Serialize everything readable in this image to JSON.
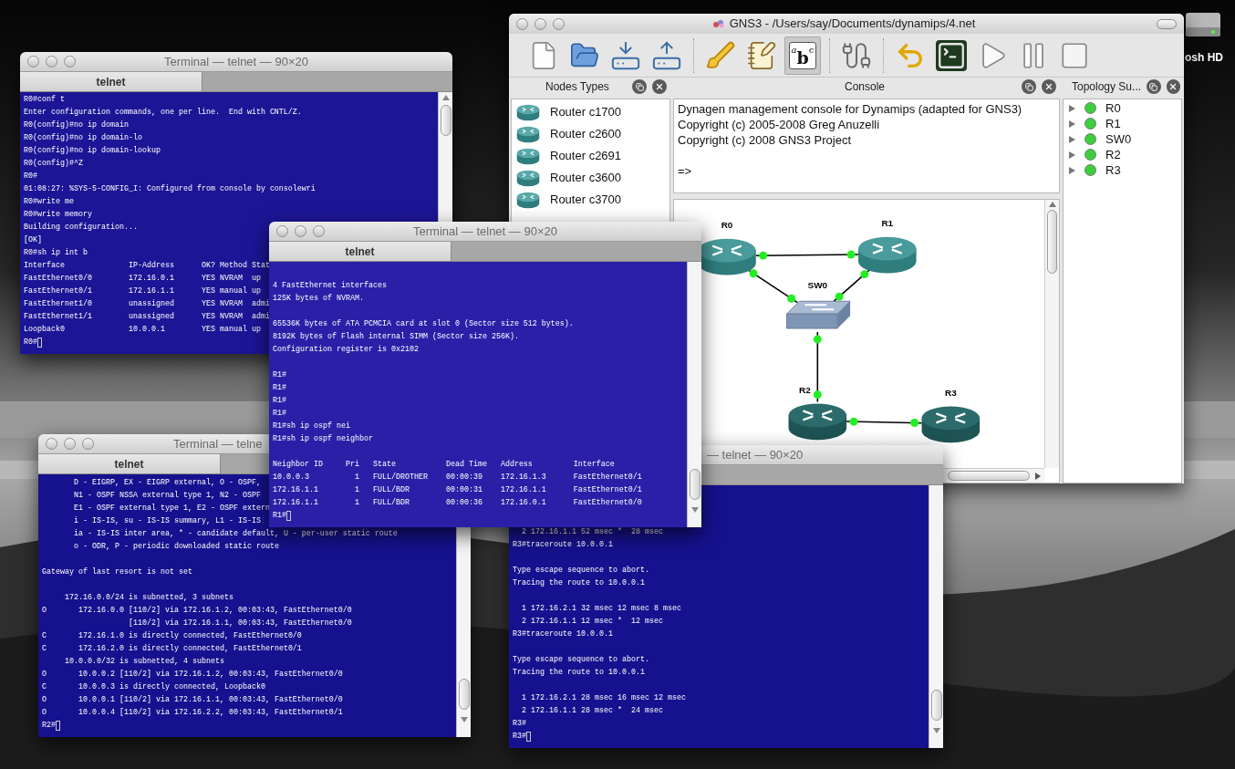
{
  "desktop": {
    "drive_label": "osh HD"
  },
  "terminals": [
    {
      "title": "Terminal — telnet — 90×20",
      "tab": "telnet",
      "cursor": true,
      "blocks": [
        [
          "R0#conf t",
          "Enter configuration commands, one per line.  End with CNTL/Z.",
          "R0(config)#no ip domain",
          "R0(config)#no ip domain-lo",
          "R0(config)#no ip domain-lookup",
          "R0(config)#^Z",
          "R0#",
          "01:08:27: %SYS-5-CONFIG_I: Configured from console by consolewri",
          "R0#write me",
          "R0#write memory",
          "Building configuration...",
          "[OK]",
          "R0#sh ip int b",
          "Interface              IP-Address      OK? Method Stat",
          "FastEthernet0/0        172.16.0.1      YES NVRAM  up",
          "FastEthernet0/1        172.16.1.1      YES manual up",
          "FastEthernet1/0        unassigned      YES NVRAM  admi",
          "FastEthernet1/1        unassigned      YES NVRAM  admi",
          "Loopback0              10.0.0.1        YES manual up",
          "R0#"
        ]
      ]
    },
    {
      "title": "Terminal — telnet — 90×20",
      "tab": "telnet",
      "cursor": true,
      "blocks": [
        [
          "4 FastEthernet interfaces",
          "125K bytes of NVRAM."
        ],
        [
          "65536K bytes of ATA PCMCIA card at slot 0 (Sector size 512 bytes).",
          "8192K bytes of Flash internal SIMM (Sector size 256K).",
          "Configuration register is 0x2102"
        ],
        [
          "R1#",
          "R1#",
          "R1#",
          "R1#",
          "R1#sh ip ospf nei",
          "R1#sh ip ospf neighbor"
        ],
        [
          "Neighbor ID     Pri   State           Dead Time   Address         Interface",
          "10.0.0.3          1   FULL/DROTHER    00:00:39    172.16.1.3      FastEthernet0/1",
          "172.16.1.1        1   FULL/BDR        00:00:31    172.16.1.1      FastEthernet0/1",
          "172.16.1.1        1   FULL/BDR        00:00:36    172.16.0.1      FastEthernet0/0",
          "R1#"
        ]
      ]
    },
    {
      "title": "Terminal — telne",
      "tab": "telnet",
      "cursor": true,
      "blocks": [
        [
          "       D - EIGRP, EX - EIGRP external, O - OSPF,",
          "       N1 - OSPF NSSA external type 1, N2 - OSPF",
          "       E1 - OSPF external type 1, E2 - OSPF extern",
          "       i - IS-IS, su - IS-IS summary, L1 - IS-IS",
          "       ia - IS-IS inter area, * - candidate default, U - per-user static route",
          "       o - ODR, P - periodic downloaded static route"
        ],
        [
          "Gateway of last resort is not set"
        ],
        [
          "     172.16.0.0/24 is subnetted, 3 subnets",
          "O       172.16.0.0 [110/2] via 172.16.1.2, 00:03:43, FastEthernet0/0",
          "                   [110/2] via 172.16.1.1, 00:03:43, FastEthernet0/0",
          "C       172.16.1.0 is directly connected, FastEthernet0/0",
          "C       172.16.2.0 is directly connected, FastEthernet0/1",
          "     10.0.0.0/32 is subnetted, 4 subnets",
          "O       10.0.0.2 [110/2] via 172.16.1.2, 00:03:43, FastEthernet0/0",
          "C       10.0.0.3 is directly connected, Loopback0",
          "O       10.0.0.1 [110/2] via 172.16.1.1, 00:03:43, FastEthernet0/0",
          "O       10.0.0.4 [110/2] via 172.16.2.2, 00:03:43, FastEthernet0/1",
          "R2#"
        ]
      ]
    },
    {
      "title": "— telnet — 90×20",
      "cursor": true,
      "blocks": [
        [
          "  2 172.16.1.1 52 msec *  28 msec",
          "R3#traceroute 10.0.0.1"
        ],
        [
          "Type escape sequence to abort.",
          "Tracing the route to 10.0.0.1"
        ],
        [
          "  1 172.16.2.1 32 msec 12 msec 8 msec",
          "  2 172.16.1.1 12 msec *  12 msec",
          "R3#traceroute 10.0.0.1"
        ],
        [
          "Type escape sequence to abort.",
          "Tracing the route to 10.0.0.1"
        ],
        [
          "  1 172.16.2.1 28 msec 16 msec 12 msec",
          "  2 172.16.1.1 28 msec *  24 msec",
          "R3#",
          "R3#"
        ]
      ]
    }
  ],
  "gns3": {
    "title": "GNS3 - /Users/say/Documents/dynamips/4.net",
    "toolbar": [
      {
        "kind": "new",
        "selected": false
      },
      {
        "kind": "open",
        "selected": false
      },
      {
        "kind": "save",
        "selected": false
      },
      {
        "kind": "save_as",
        "selected": false
      },
      {
        "kind": "separator"
      },
      {
        "kind": "clear",
        "selected": false
      },
      {
        "kind": "notes",
        "selected": false
      },
      {
        "kind": "text",
        "label": "abc",
        "selected": true
      },
      {
        "kind": "separator"
      },
      {
        "kind": "cable",
        "selected": false
      },
      {
        "kind": "separator"
      },
      {
        "kind": "undo",
        "selected": false
      },
      {
        "kind": "terminal",
        "selected": false
      },
      {
        "kind": "play",
        "selected": false
      },
      {
        "kind": "pause",
        "selected": false
      },
      {
        "kind": "stop",
        "selected": false
      }
    ],
    "nodes_panel": {
      "title": "Nodes Types",
      "items": [
        {
          "label": "Router c1700"
        },
        {
          "label": "Router c2600"
        },
        {
          "label": "Router c2691"
        },
        {
          "label": "Router c3600"
        },
        {
          "label": "Router c3700"
        }
      ]
    },
    "console": {
      "title": "Console",
      "blocks": [
        [
          "Dynagen management console for Dynamips (adapted for GNS3)",
          "Copyright (c) 2005-2008 Greg Anuzelli",
          "Copyright (c) 2008 GNS3 Project"
        ],
        [
          "=>"
        ]
      ]
    },
    "topology": {
      "nodes": [
        {
          "label": "R0",
          "kind": "router"
        },
        {
          "label": "R1",
          "kind": "router"
        },
        {
          "label": "SW0",
          "kind": "switch"
        },
        {
          "label": "R2",
          "kind": "router"
        },
        {
          "label": "R3",
          "kind": "router"
        }
      ]
    },
    "summary": {
      "title": "Topology Su...",
      "items": [
        {
          "label": "R0",
          "expanded": false
        },
        {
          "label": "R1",
          "expanded": false
        },
        {
          "label": "SW0",
          "expanded": false
        },
        {
          "label": "R2",
          "expanded": false
        },
        {
          "label": "R3",
          "expanded": false
        }
      ]
    }
  }
}
